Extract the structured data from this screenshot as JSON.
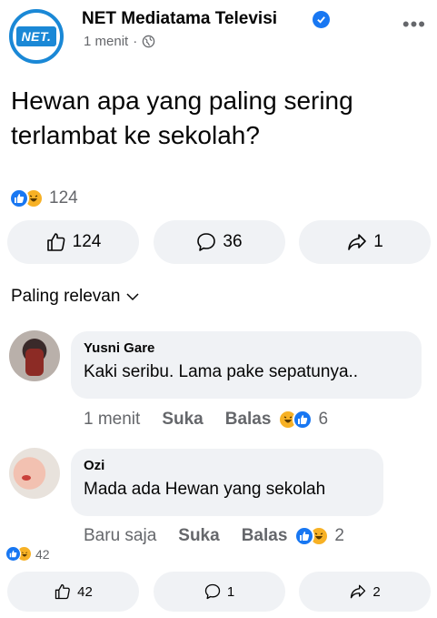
{
  "post": {
    "page_name": "NET Mediatama Televisi",
    "logo_text": "NET.",
    "time": "1 menit",
    "separator": "·",
    "more": "•••",
    "text": "Hewan apa yang paling sering terlambat ke sekolah?",
    "reaction_count": "124",
    "actions": {
      "like_count": "124",
      "comment_count": "36",
      "share_count": "1"
    }
  },
  "filter": {
    "label": "Paling relevan"
  },
  "comments": [
    {
      "author": "Yusni Gare",
      "text": "Kaki seribu. Lama pake sepatunya..",
      "time": "1 menit",
      "like_label": "Suka",
      "reply_label": "Balas",
      "reaction_count": "6"
    },
    {
      "author": "Ozi",
      "text": "Mada ada Hewan yang sekolah",
      "time": "Baru saja",
      "like_label": "Suka",
      "reply_label": "Balas",
      "reaction_count": "2"
    }
  ],
  "next_post": {
    "reaction_count": "42",
    "like_count": "42",
    "comment_count": "1",
    "share_count": "2"
  },
  "colors": {
    "facebook_blue": "#1877f2",
    "net_blue": "#1a88d6",
    "haha_yellow": "#f7b125",
    "bubble_gray": "#f0f2f5",
    "secondary_text": "#65676b"
  },
  "icons": [
    "verified-badge-icon",
    "globe-icon",
    "like-reaction-icon",
    "haha-reaction-icon",
    "thumbs-up-icon",
    "comment-icon",
    "share-icon",
    "chevron-down-icon"
  ]
}
